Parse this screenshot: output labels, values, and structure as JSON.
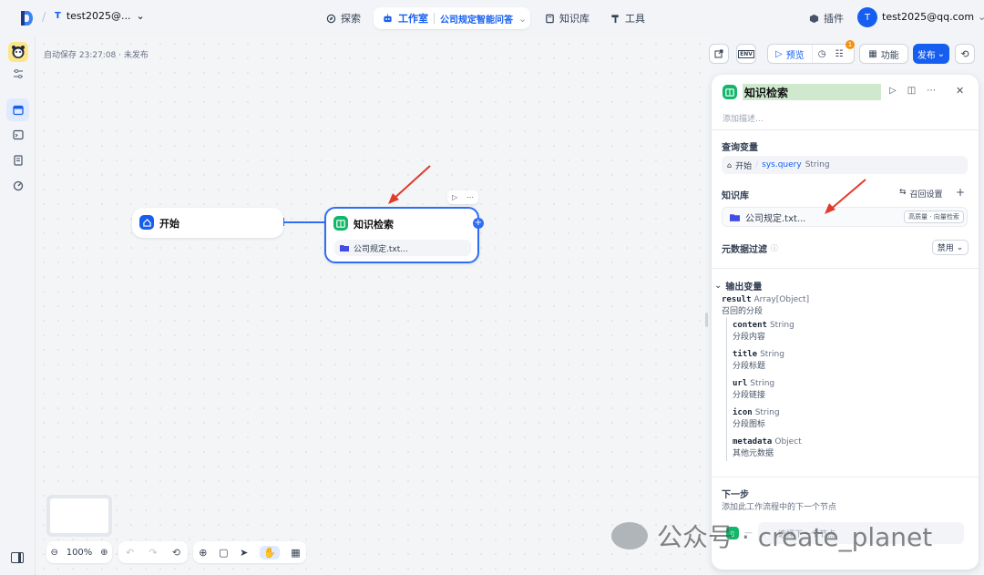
{
  "topbar": {
    "workspace_letter": "T",
    "workspace_name": "test2025@...",
    "nav": {
      "explore": "探索",
      "studio": "工作室",
      "app_name": "公司规定智能问答",
      "knowledge": "知识库",
      "tools": "工具"
    },
    "plugins": "插件",
    "user_initial": "T",
    "user_email": "test2025@qq.com"
  },
  "canvas": {
    "autosave": "自动保存 23:27:08 · 未发布",
    "start_node": {
      "title": "开始"
    },
    "kr_node": {
      "title": "知识检索",
      "file": "公司规定.txt..."
    },
    "zoom": "100%"
  },
  "actions": {
    "env_label": "ENV",
    "preview": "预览",
    "checklist_badge": "1",
    "features": "功能",
    "publish": "发布"
  },
  "panel": {
    "title": "知识检索",
    "desc_placeholder": "添加描述...",
    "query_label": "查询变量",
    "query": {
      "source": "开始",
      "var": "sys.query",
      "type": "String"
    },
    "kb_label": "知识库",
    "recall_settings": "召回设置",
    "kb_file": "公司规定.txt...",
    "kb_tag": "高质量 · 向量检索",
    "meta_label": "元数据过滤",
    "meta_value": "禁用",
    "output_label": "输出变量",
    "result": {
      "name": "result",
      "type": "Array[Object]",
      "desc": "召回的分段"
    },
    "children": [
      {
        "name": "content",
        "type": "String",
        "desc": "分段内容"
      },
      {
        "name": "title",
        "type": "String",
        "desc": "分段标题"
      },
      {
        "name": "url",
        "type": "String",
        "desc": "分段链接"
      },
      {
        "name": "icon",
        "type": "String",
        "desc": "分段图标"
      },
      {
        "name": "metadata",
        "type": "Object",
        "desc": "其他元数据"
      }
    ],
    "next_title": "下一步",
    "next_desc": "添加此工作流程中的下一个节点",
    "next_select": "选择下一个节点"
  },
  "watermark": "公众号 · create_planet",
  "colors": {
    "accent": "#155eef",
    "node_green": "#12b76a",
    "title_highlight": "#cfe9cf",
    "arrow": "#e03b2e"
  }
}
